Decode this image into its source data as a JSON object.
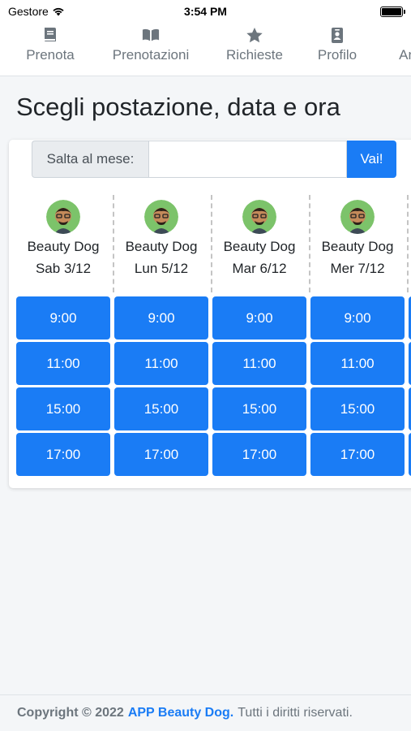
{
  "status_bar": {
    "carrier": "Gestore",
    "time": "3:54 PM"
  },
  "nav": {
    "items": [
      {
        "label": "Prenota",
        "icon": "book-icon"
      },
      {
        "label": "Prenotazioni",
        "icon": "open-book-icon"
      },
      {
        "label": "Richieste",
        "icon": "star-icon"
      },
      {
        "label": "Profilo",
        "icon": "id-badge-icon"
      },
      {
        "label": "Animali",
        "icon": "paw-icon"
      }
    ]
  },
  "page": {
    "title": "Scegli postazione, data e ora"
  },
  "month_jump": {
    "label": "Salta al mese:",
    "value": "",
    "placeholder": "",
    "button": "Vai!"
  },
  "columns": [
    {
      "name": "Beauty Dog",
      "date": "Sab 3/12",
      "slots": [
        "9:00",
        "11:00",
        "15:00",
        "17:00"
      ]
    },
    {
      "name": "Beauty Dog",
      "date": "Lun 5/12",
      "slots": [
        "9:00",
        "11:00",
        "15:00",
        "17:00"
      ]
    },
    {
      "name": "Beauty Dog",
      "date": "Mar 6/12",
      "slots": [
        "9:00",
        "11:00",
        "15:00",
        "17:00"
      ]
    },
    {
      "name": "Beauty Dog",
      "date": "Mer 7/12",
      "slots": [
        "9:00",
        "11:00",
        "15:00",
        "17:00"
      ]
    }
  ],
  "footer": {
    "copyright": "Copyright © 2022",
    "brand": "APP Beauty Dog.",
    "rights": "Tutti i diritti riservati."
  },
  "colors": {
    "accent": "#1a7cf5",
    "muted": "#6c757d"
  }
}
